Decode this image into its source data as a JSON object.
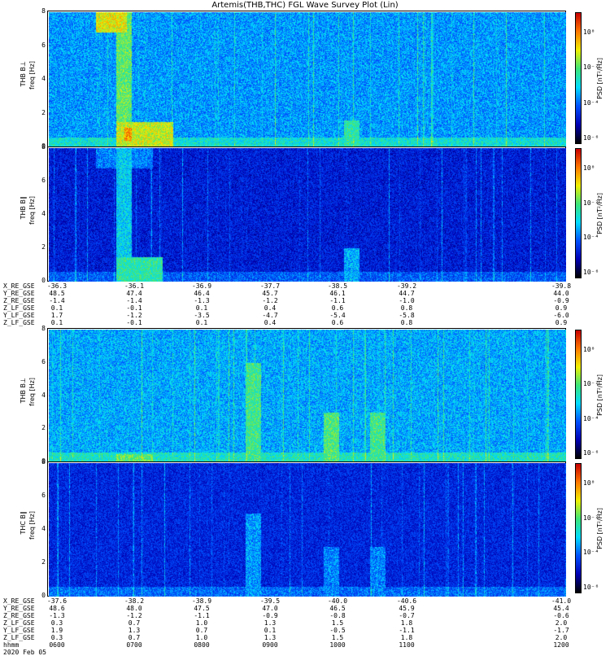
{
  "title": "Artemis(THB,THC) FGL Wave Survey Plot (Lin)",
  "colors": {
    "background": "#ffffff",
    "axis": "#000000"
  },
  "chart_data": [
    {
      "type": "heatmap",
      "probe_group": "upper",
      "ylabel_line1": "THB B⊥",
      "ylabel_line2": "freq [Hz]",
      "yticks": [
        "0",
        "2",
        "4",
        "6",
        "8"
      ],
      "ylim": [
        0,
        8
      ],
      "colorbar_label": "PSD [nT²/Hz]",
      "colorbar_ticks": [
        "10⁰",
        "10⁻²",
        "10⁻⁴",
        "10⁻⁶"
      ],
      "base_level": 0.38,
      "features": [
        {
          "t0": 0.09,
          "t1": 0.15,
          "f0": 6.8,
          "f1": 8.0,
          "level": 0.75
        },
        {
          "t0": 0.13,
          "t1": 0.16,
          "f0": 0.0,
          "f1": 8.0,
          "level": 0.62
        },
        {
          "t0": 0.13,
          "t1": 0.24,
          "f0": 0.0,
          "f1": 1.5,
          "level": 0.72
        },
        {
          "t0": 0.145,
          "t1": 0.16,
          "f0": 0.4,
          "f1": 1.2,
          "level": 0.85
        },
        {
          "t0": 0.57,
          "t1": 0.6,
          "f0": 0.0,
          "f1": 1.6,
          "level": 0.55
        },
        {
          "t0": 0.79,
          "t1": 0.81,
          "f0": 0.0,
          "f1": 1.0,
          "level": 0.22
        }
      ]
    },
    {
      "type": "heatmap",
      "probe_group": "upper",
      "ylabel_line1": "THB B∥",
      "ylabel_line2": "freq [Hz]",
      "yticks": [
        "0",
        "2",
        "4",
        "6",
        "8"
      ],
      "ylim": [
        0,
        8
      ],
      "colorbar_label": "PSD [nT²/Hz]",
      "colorbar_ticks": [
        "10⁰",
        "10⁻²",
        "10⁻⁴",
        "10⁻⁶"
      ],
      "base_level": 0.18,
      "features": [
        {
          "t0": 0.13,
          "t1": 0.16,
          "f0": 0.0,
          "f1": 8.0,
          "level": 0.45
        },
        {
          "t0": 0.13,
          "t1": 0.22,
          "f0": 0.0,
          "f1": 1.5,
          "level": 0.55
        },
        {
          "t0": 0.09,
          "t1": 0.2,
          "f0": 6.8,
          "f1": 8.0,
          "level": 0.35
        },
        {
          "t0": 0.57,
          "t1": 0.6,
          "f0": 0.0,
          "f1": 2.0,
          "level": 0.4
        },
        {
          "t0": 0.71,
          "t1": 0.93,
          "f0": 0.0,
          "f1": 2.5,
          "level": 0.08
        }
      ]
    },
    {
      "type": "heatmap",
      "probe_group": "lower",
      "ylabel_line1": "THB B⊥",
      "ylabel_line2": "freq [Hz]",
      "yticks": [
        "0",
        "2",
        "4",
        "6",
        "8"
      ],
      "ylim": [
        0,
        8
      ],
      "colorbar_label": "PSD [nT²/Hz]",
      "colorbar_ticks": [
        "10⁰",
        "10⁻²",
        "10⁻⁴",
        "10⁻⁶"
      ],
      "base_level": 0.4,
      "features": [
        {
          "t0": 0.38,
          "t1": 0.41,
          "f0": 0.0,
          "f1": 6.0,
          "level": 0.58
        },
        {
          "t0": 0.53,
          "t1": 0.56,
          "f0": 0.0,
          "f1": 3.0,
          "level": 0.6
        },
        {
          "t0": 0.62,
          "t1": 0.65,
          "f0": 0.0,
          "f1": 3.0,
          "level": 0.58
        },
        {
          "t0": 0.13,
          "t1": 0.2,
          "f0": 0.0,
          "f1": 0.5,
          "level": 0.62
        },
        {
          "t0": 0.8,
          "t1": 0.9,
          "f0": 0.0,
          "f1": 5.0,
          "level": 0.28
        }
      ]
    },
    {
      "type": "heatmap",
      "probe_group": "lower",
      "ylabel_line1": "THC B∥",
      "ylabel_line2": "freq [Hz]",
      "yticks": [
        "0",
        "2",
        "4",
        "6",
        "8"
      ],
      "ylim": [
        0,
        8
      ],
      "colorbar_label": "PSD [nT²/Hz]",
      "colorbar_ticks": [
        "10⁰",
        "10⁻²",
        "10⁻⁴",
        "10⁻⁶"
      ],
      "base_level": 0.2,
      "features": [
        {
          "t0": 0.0,
          "t1": 0.12,
          "f0": 0.0,
          "f1": 2.5,
          "level": 0.1
        },
        {
          "t0": 0.38,
          "t1": 0.41,
          "f0": 0.0,
          "f1": 5.0,
          "level": 0.38
        },
        {
          "t0": 0.53,
          "t1": 0.56,
          "f0": 0.0,
          "f1": 3.0,
          "level": 0.35
        },
        {
          "t0": 0.62,
          "t1": 0.65,
          "f0": 0.0,
          "f1": 3.0,
          "level": 0.35
        },
        {
          "t0": 0.74,
          "t1": 0.93,
          "f0": 0.0,
          "f1": 2.5,
          "level": 0.08
        }
      ]
    }
  ],
  "upper_axis": {
    "rows": [
      {
        "label": "X_RE_GSE",
        "values": [
          "-36.3",
          "-36.1",
          "-36.9",
          "-37.7",
          "-38.5",
          "-39.2",
          "-39.8"
        ]
      },
      {
        "label": "Y_RE_GSE",
        "values": [
          "48.5",
          "47.4",
          "46.4",
          "45.7",
          "46.1",
          "44.7",
          "44.0"
        ]
      },
      {
        "label": "Z_RE_GSE",
        "values": [
          "-1.4",
          "-1.4",
          "-1.3",
          "-1.2",
          "-1.1",
          "-1.0",
          "-0.9"
        ]
      },
      {
        "label": "Z_LF_GSE",
        "values": [
          "0.1",
          "-0.1",
          "0.1",
          "0.4",
          "0.6",
          "0.8",
          "0.9"
        ]
      },
      {
        "label": "Y_LF_GSE",
        "values": [
          "1.7",
          "-1.2",
          "-3.5",
          "-4.7",
          "-5.4",
          "-5.8",
          "-6.0"
        ]
      },
      {
        "label": "Z_LF_GSE",
        "values": [
          "0.1",
          "-0.1",
          "0.1",
          "0.4",
          "0.6",
          "0.8",
          "0.9"
        ]
      }
    ]
  },
  "lower_axis": {
    "rows": [
      {
        "label": "X_RE_GSE",
        "values": [
          "-37.6",
          "-38.2",
          "-38.9",
          "-39.5",
          "-40.0",
          "-40.6",
          "-41.0"
        ]
      },
      {
        "label": "Y_RE_GSE",
        "values": [
          "48.6",
          "48.0",
          "47.5",
          "47.0",
          "46.5",
          "45.9",
          "45.4"
        ]
      },
      {
        "label": "Z_RE_GSE",
        "values": [
          "-1.3",
          "-1.2",
          "-1.1",
          "-0.9",
          "-0.8",
          "-0.7",
          "-0.6"
        ]
      },
      {
        "label": "Z_LF_GSE",
        "values": [
          "0.3",
          "0.7",
          "1.0",
          "1.3",
          "1.5",
          "1.8",
          "2.0"
        ]
      },
      {
        "label": "Y_LF_GSE",
        "values": [
          "1.9",
          "1.3",
          "0.7",
          "0.1",
          "-0.5",
          "-1.1",
          "-1.7"
        ]
      },
      {
        "label": "Z_LF_GSE",
        "values": [
          "0.3",
          "0.7",
          "1.0",
          "1.3",
          "1.5",
          "1.8",
          "2.0"
        ]
      },
      {
        "label": "hhmm",
        "values": [
          "0600",
          "0700",
          "0800",
          "0900",
          "1000",
          "1100",
          "1200"
        ]
      },
      {
        "label": "2020 Feb 05",
        "values": []
      }
    ]
  }
}
